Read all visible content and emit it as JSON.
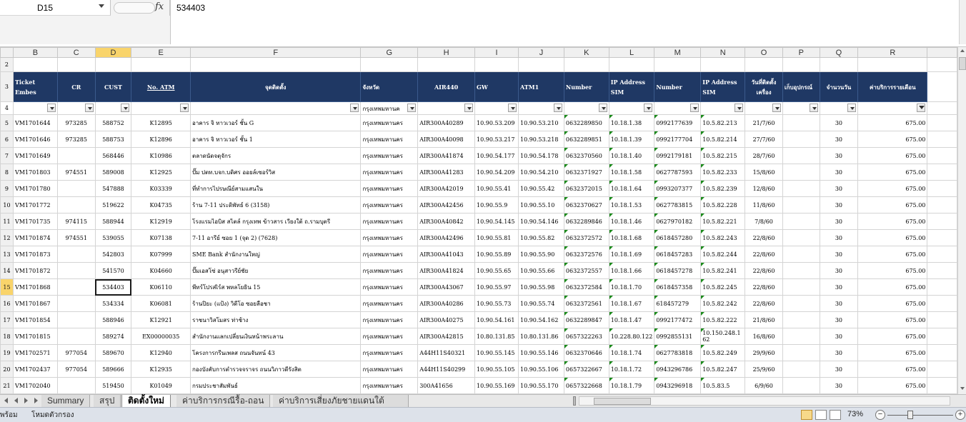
{
  "formula_bar": {
    "name_box": "D15",
    "fx": "fx",
    "content": "534403"
  },
  "columns": [
    {
      "letter": "B",
      "selected": false
    },
    {
      "letter": "C",
      "selected": false
    },
    {
      "letter": "D",
      "selected": true
    },
    {
      "letter": "E",
      "selected": false
    },
    {
      "letter": "F",
      "selected": false
    },
    {
      "letter": "G",
      "selected": false
    },
    {
      "letter": "H",
      "selected": false
    },
    {
      "letter": "I",
      "selected": false
    },
    {
      "letter": "J",
      "selected": false
    },
    {
      "letter": "K",
      "selected": false
    },
    {
      "letter": "L",
      "selected": false
    },
    {
      "letter": "M",
      "selected": false
    },
    {
      "letter": "N",
      "selected": false
    },
    {
      "letter": "O",
      "selected": false
    },
    {
      "letter": "P",
      "selected": false
    },
    {
      "letter": "Q",
      "selected": false
    },
    {
      "letter": "R",
      "selected": false
    }
  ],
  "header_row_number": "3",
  "filter_row_number": "4",
  "blank_row_number": "2",
  "headers": [
    "Ticket Embes",
    "CR",
    "CUST",
    "No. ATM",
    "จุดติดตั้ง",
    "จังหวัด",
    "AIR440",
    "GW",
    "ATM1",
    "Number",
    "IP Address SIM",
    "Number",
    "IP Address SIM",
    "วันที่ติดตั้งเครื่อง",
    "เก็บอุปกรณ์",
    "จำนวนวัน",
    "ค่าบริการรายเดือน"
  ],
  "filter_values": {
    "province": "กรุงเทพมหานค"
  },
  "rows": [
    {
      "num": "5",
      "ticket": "VM1701644",
      "cr": "973285",
      "cust": "588752",
      "atm": "K12895",
      "location": "อาคาร จิ ทาวเวอร์ ชั้น G",
      "province": "กรุงเทพมหานคร",
      "air": "AIR300A40289",
      "gw": "10.90.53.209",
      "atm1": "10.90.53.210",
      "number1": "0632289850",
      "ip1": "10.18.1.38",
      "number2": "0992177639",
      "ip2": "10.5.82.213",
      "date": "21/7/60",
      "collect": "",
      "days": "30",
      "fee": "675.00"
    },
    {
      "num": "6",
      "ticket": "VM1701646",
      "cr": "973285",
      "cust": "588753",
      "atm": "K12896",
      "location": "อาคาร จิ ทาวเวอร์ ชั้น 1",
      "province": "กรุงเทพมหานคร",
      "air": "AIR300A40098",
      "gw": "10.90.53.217",
      "atm1": "10.90.53.218",
      "number1": "0632289851",
      "ip1": "10.18.1.39",
      "number2": "0992177704",
      "ip2": "10.5.82.214",
      "date": "27/7/60",
      "collect": "",
      "days": "30",
      "fee": "675.00"
    },
    {
      "num": "7",
      "ticket": "VM1701649",
      "cr": "",
      "cust": "568446",
      "atm": "K10986",
      "location": "ตลาดนัดจตุจักร",
      "province": "กรุงเทพมหานคร",
      "air": "AIR300A41874",
      "gw": "10.90.54.177",
      "atm1": "10.90.54.178",
      "number1": "0632370560",
      "ip1": "10.18.1.40",
      "number2": "0992179181",
      "ip2": "10.5.82.215",
      "date": "28/7/60",
      "collect": "",
      "days": "30",
      "fee": "675.00"
    },
    {
      "num": "8",
      "ticket": "VM1701803",
      "cr": "974551",
      "cust": "589008",
      "atm": "K12925",
      "location": "ปั๊ม ปตท.บจก.บดิศร ออยล์เซอร์วิส",
      "province": "กรุงเทพมหานคร",
      "air": "AIR300A41283",
      "gw": "10.90.54.209",
      "atm1": "10.90.54.210",
      "number1": "0632371927",
      "ip1": "10.18.1.58",
      "number2": "0627787593",
      "ip2": "10.5.82.233",
      "date": "15/8/60",
      "collect": "",
      "days": "30",
      "fee": "675.00"
    },
    {
      "num": "9",
      "ticket": "VM1701780",
      "cr": "",
      "cust": "547888",
      "atm": "K03339",
      "location": "ที่ทำการไปรษณีย์สามแสนใน",
      "province": "กรุงเทพมหานคร",
      "air": "AIR300A42019",
      "gw": "10.90.55.41",
      "atm1": "10.90.55.42",
      "number1": "0632372015",
      "ip1": "10.18.1.64",
      "number2": "0993207377",
      "ip2": "10.5.82.239",
      "date": "12/8/60",
      "collect": "",
      "days": "30",
      "fee": "675.00"
    },
    {
      "num": "10",
      "ticket": "VM1701772",
      "cr": "",
      "cust": "519622",
      "atm": "K04735",
      "location": "ร้าน 7-11 ประดิพัทธ์ 6 (3158)",
      "province": "กรุงเทพมหานคร",
      "air": "AIR300A42456",
      "gw": "10.90.55.9",
      "atm1": "10.90.55.10",
      "number1": "0632370627",
      "ip1": "10.18.1.53",
      "number2": "0627783815",
      "ip2": "10.5.82.228",
      "date": "11/8/60",
      "collect": "",
      "days": "30",
      "fee": "675.00"
    },
    {
      "num": "11",
      "ticket": "VM1701735",
      "cr": "974115",
      "cust": "588944",
      "atm": "K12919",
      "location": "โรงแรมไอบิส สไตล์ กรุงเทพ ข้าวสาร เวียงใต้ ถ.รามบุตรี",
      "province": "กรุงเทพมหานคร",
      "air": "AIR300A40842",
      "gw": "10.90.54.145",
      "atm1": "10.90.54.146",
      "number1": "0632289846",
      "ip1": "10.18.1.46",
      "number2": "0627970182",
      "ip2": "10.5.82.221",
      "date": "7/8/60",
      "collect": "",
      "days": "30",
      "fee": "675.00"
    },
    {
      "num": "12",
      "ticket": "VM1701874",
      "cr": "974551",
      "cust": "539055",
      "atm": "K07138",
      "location": "7-11 อารีย์ ซอย 1 (จุด 2) (7628)",
      "province": "กรุงเทพมหานคร",
      "air": "AIR300A42496",
      "gw": "10.90.55.81",
      "atm1": "10.90.55.82",
      "number1": "0632372572",
      "ip1": "10.18.1.68",
      "number2": "0618457280",
      "ip2": "10.5.82.243",
      "date": "22/8/60",
      "collect": "",
      "days": "30",
      "fee": "675.00"
    },
    {
      "num": "13",
      "ticket": "VM1701873",
      "cr": "",
      "cust": "542803",
      "atm": "K07999",
      "location": "SME Bank สำนักงานใหญ่",
      "province": "กรุงเทพมหานคร",
      "air": "AIR300A41043",
      "gw": "10.90.55.89",
      "atm1": "10.90.55.90",
      "number1": "0632372576",
      "ip1": "10.18.1.69",
      "number2": "0618457283",
      "ip2": "10.5.82.244",
      "date": "22/8/60",
      "collect": "",
      "days": "30",
      "fee": "675.00"
    },
    {
      "num": "14",
      "ticket": "VM1701872",
      "cr": "",
      "cust": "541570",
      "atm": "K04660",
      "location": "ปั๊มเอสโซ่ อนุสาวรีย์ชัย",
      "province": "กรุงเทพมหานคร",
      "air": "AIR300A41824",
      "gw": "10.90.55.65",
      "atm1": "10.90.55.66",
      "number1": "0632372557",
      "ip1": "10.18.1.66",
      "number2": "0618457278",
      "ip2": "10.5.82.241",
      "date": "22/8/60",
      "collect": "",
      "days": "30",
      "fee": "675.00"
    },
    {
      "num": "15",
      "ticket": "VM1701868",
      "cr": "",
      "cust": "534403",
      "atm": "K06110",
      "location": "พีทร์โปรสเิร์ส พหลโยธิน 15",
      "province": "กรุงเทพมหานคร",
      "air": "AIR300A43067",
      "gw": "10.90.55.97",
      "atm1": "10.90.55.98",
      "number1": "0632372584",
      "ip1": "10.18.1.70",
      "number2": "0618457358",
      "ip2": "10.5.82.245",
      "date": "22/8/60",
      "collect": "",
      "days": "30",
      "fee": "675.00"
    },
    {
      "num": "16",
      "ticket": "VM1701867",
      "cr": "",
      "cust": "534334",
      "atm": "K06081",
      "location": "ร้านปิยะ (แป้ง) วิดีโอ ซอยลือชา",
      "province": "กรุงเทพมหานคร",
      "air": "AIR300A40286",
      "gw": "10.90.55.73",
      "atm1": "10.90.55.74",
      "number1": "0632372561",
      "ip1": "10.18.1.67",
      "number2": "618457279",
      "ip2": "10.5.82.242",
      "date": "22/8/60",
      "collect": "",
      "days": "30",
      "fee": "675.00"
    },
    {
      "num": "17",
      "ticket": "VM1701854",
      "cr": "",
      "cust": "588946",
      "atm": "K12921",
      "location": "ราชนาวิสโมสร ท่าช้าง",
      "province": "กรุงเทพมหานคร",
      "air": "AIR300A40275",
      "gw": "10.90.54.161",
      "atm1": "10.90.54.162",
      "number1": "0632289847",
      "ip1": "10.18.1.47",
      "number2": "0992177472",
      "ip2": "10.5.82.222",
      "date": "21/8/60",
      "collect": "",
      "days": "30",
      "fee": "675.00"
    },
    {
      "num": "18",
      "ticket": "VM1701815",
      "cr": "",
      "cust": "589274",
      "atm": "EX00000035",
      "location": "สำนักงานแลกเปลี่ยนเงินหน้าพระลาน",
      "province": "กรุงเทพมหานคร",
      "air": "AIR300A42815",
      "gw": "10.80.131.85",
      "atm1": "10.80.131.86",
      "number1": "0657322263",
      "ip1": "10.228.80.122",
      "number2": "0992855131",
      "ip2": "10.150.248.1 62",
      "date": "16/8/60",
      "collect": "",
      "days": "30",
      "fee": "675.00"
    },
    {
      "num": "19",
      "ticket": "VM1702571",
      "cr": "977054",
      "cust": "589670",
      "atm": "K12940",
      "location": "โครงการกรีนเพลส ถนนจันทน์ 43",
      "province": "กรุงเทพมหานคร",
      "air": "A44H11S40321",
      "gw": "10.90.55.145",
      "atm1": "10.90.55.146",
      "number1": "0632370646",
      "ip1": "10.18.1.74",
      "number2": "0627783818",
      "ip2": "10.5.82.249",
      "date": "29/9/60",
      "collect": "",
      "days": "30",
      "fee": "675.00"
    },
    {
      "num": "20",
      "ticket": "VM1702437",
      "cr": "977054",
      "cust": "589666",
      "atm": "K12935",
      "location": "กองบังคับการตำรวจจราจร ถนนวิภาวดีรังสิต",
      "province": "กรุงเทพมหานคร",
      "air": "A44H11S40299",
      "gw": "10.90.55.105",
      "atm1": "10.90.55.106",
      "number1": "0657322667",
      "ip1": "10.18.1.72",
      "number2": "0943296786",
      "ip2": "10.5.82.247",
      "date": "25/9/60",
      "collect": "",
      "days": "30",
      "fee": "675.00"
    },
    {
      "num": "21",
      "ticket": "VM1702040",
      "cr": "",
      "cust": "519450",
      "atm": "K01049",
      "location": "กรมประชาสัมพันธ์",
      "province": "กรุงเทพมหานคร",
      "air": "300A41656",
      "gw": "10.90.55.169",
      "atm1": "10.90.55.170",
      "number1": "0657322668",
      "ip1": "10.18.1.79",
      "number2": "0943296918",
      "ip2": "10.5.83.5",
      "date": "6/9/60",
      "collect": "",
      "days": "30",
      "fee": "675.00"
    }
  ],
  "sheet_tabs": [
    {
      "label": "Summary",
      "active": false
    },
    {
      "label": "สรุป",
      "active": false
    },
    {
      "label": "ติดตั้งใหม่",
      "active": true
    },
    {
      "label": "ค่าบริการกรณีรื้อ-ถอน",
      "active": false
    },
    {
      "label": "ค่าบริการเสี่ยงภัยชายแดนใต้",
      "active": false
    }
  ],
  "status_bar": {
    "ready": "พร้อม",
    "mode": "โหมดตัวกรอง",
    "zoom": "73%",
    "minus": "−",
    "plus": "+"
  }
}
